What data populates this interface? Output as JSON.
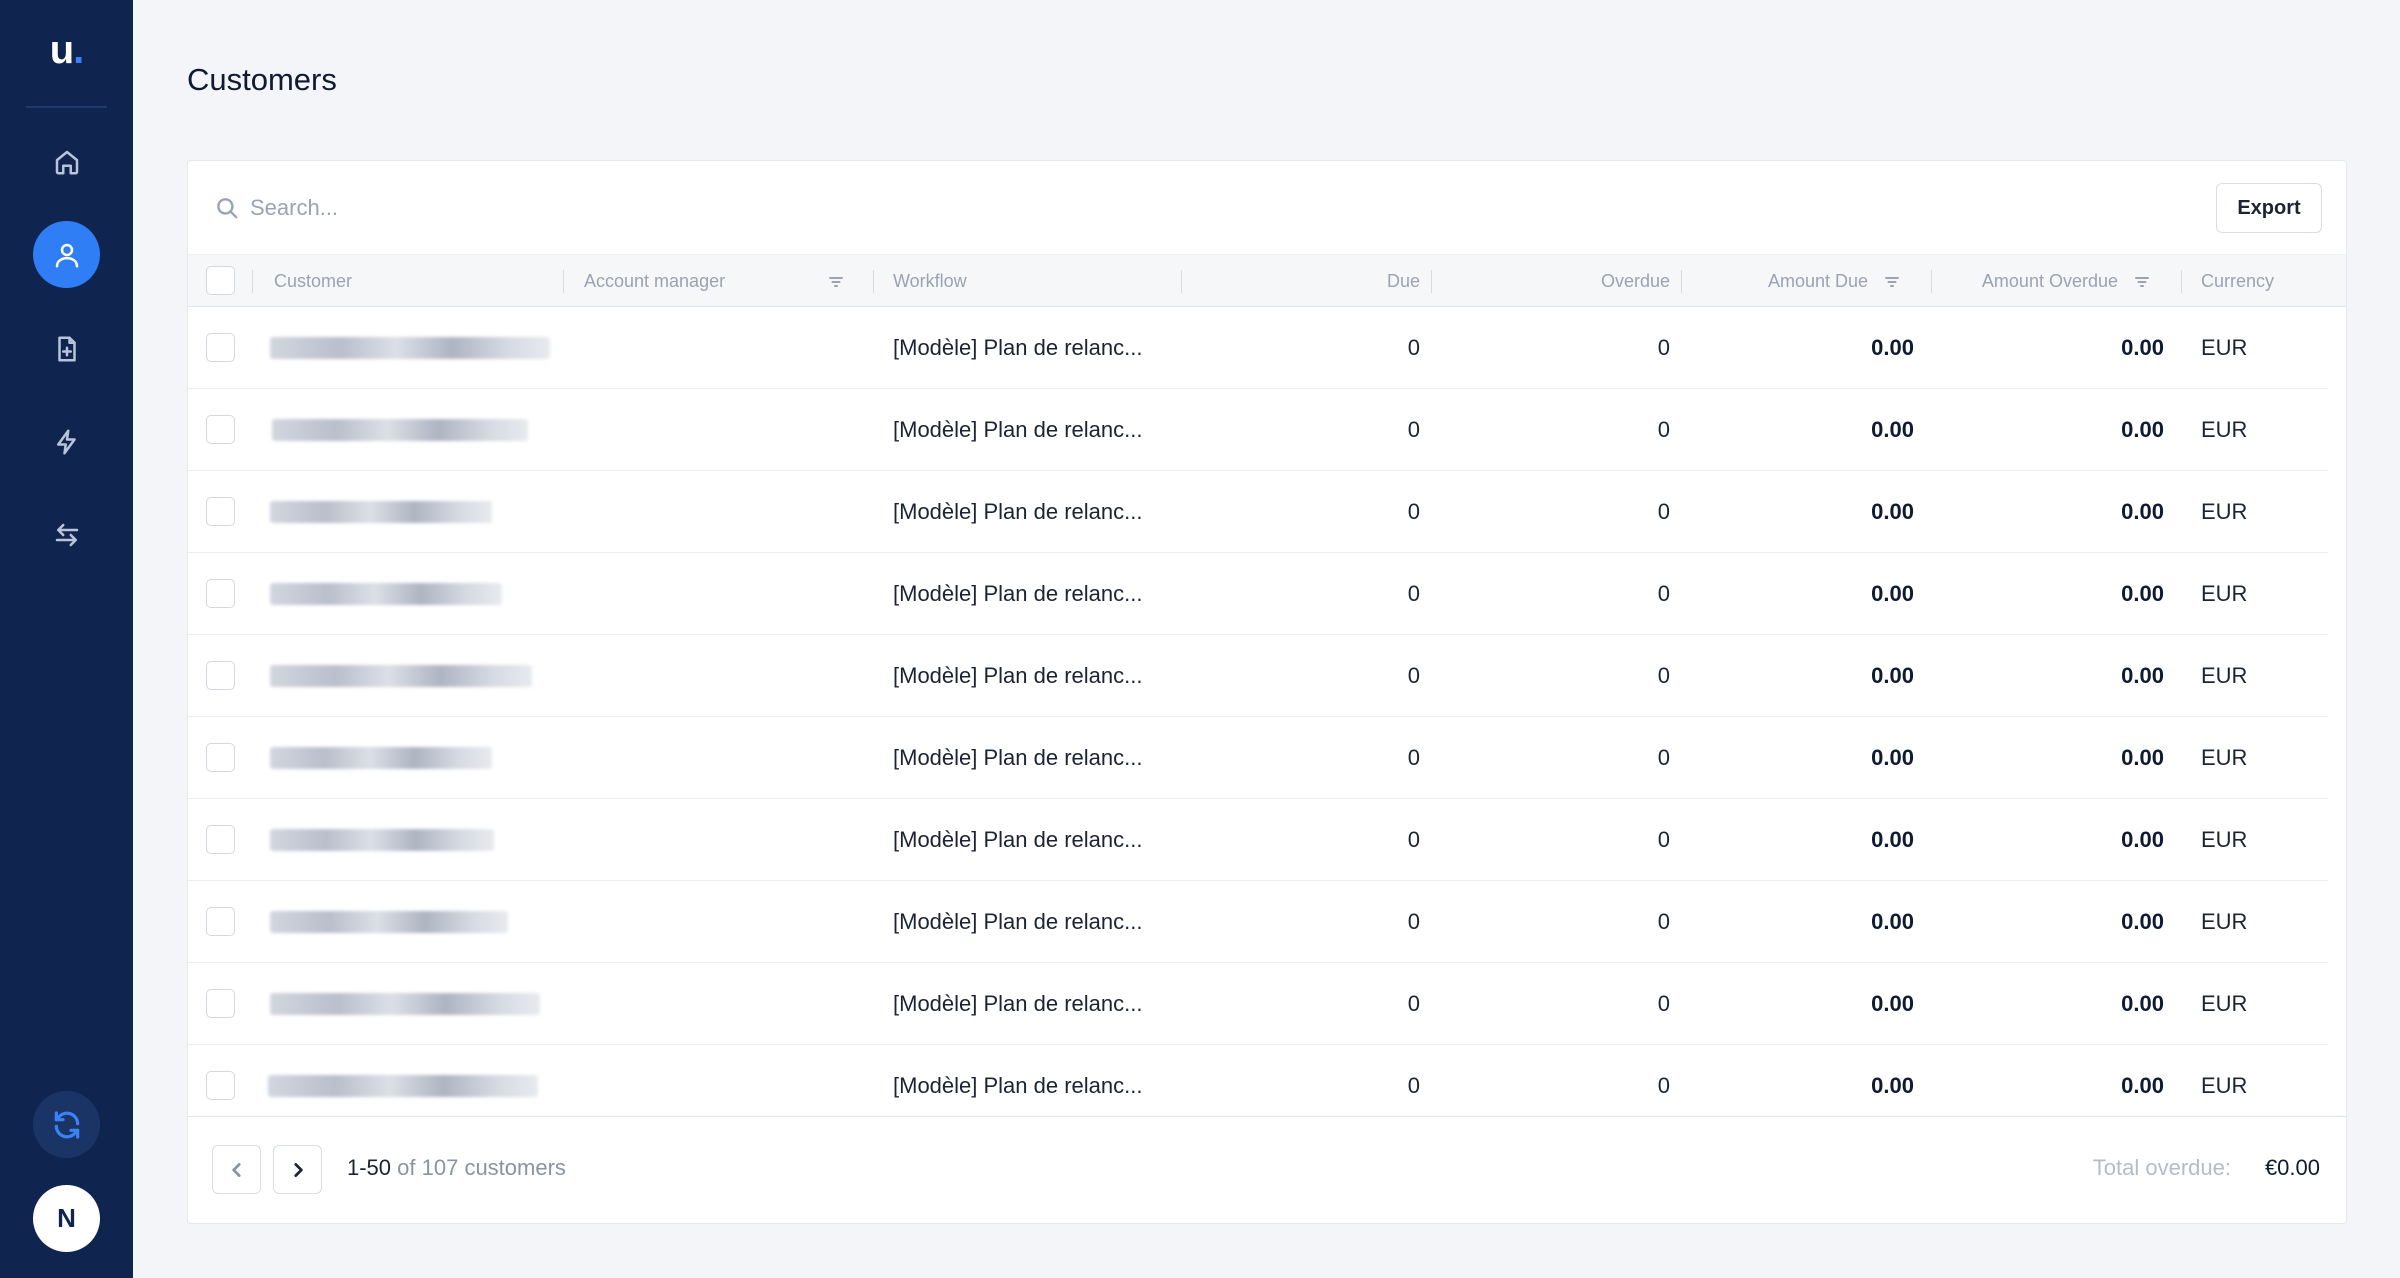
{
  "app": {
    "logo_text": "u",
    "logo_dot": "."
  },
  "sidebar": {
    "items": [
      {
        "name": "home-icon",
        "active": false
      },
      {
        "name": "user-icon",
        "active": true
      },
      {
        "name": "document-icon",
        "active": false
      },
      {
        "name": "lightning-icon",
        "active": false
      },
      {
        "name": "transfer-icon",
        "active": false
      }
    ],
    "sync_icon": "sync-icon",
    "avatar_initial": "N"
  },
  "page": {
    "title": "Customers"
  },
  "toolbar": {
    "search_placeholder": "Search...",
    "search_value": "",
    "export_label": "Export"
  },
  "table": {
    "columns": {
      "customer": "Customer",
      "account_manager": "Account manager",
      "workflow": "Workflow",
      "due": "Due",
      "overdue": "Overdue",
      "amount_due": "Amount Due",
      "amount_overdue": "Amount Overdue",
      "currency": "Currency"
    },
    "rows": [
      {
        "account_manager": "",
        "workflow": "[Modèle] Plan de relanc...",
        "due": "0",
        "overdue": "0",
        "amount_due": "0.00",
        "amount_overdue": "0.00",
        "currency": "EUR"
      },
      {
        "account_manager": "",
        "workflow": "[Modèle] Plan de relanc...",
        "due": "0",
        "overdue": "0",
        "amount_due": "0.00",
        "amount_overdue": "0.00",
        "currency": "EUR"
      },
      {
        "account_manager": "",
        "workflow": "[Modèle] Plan de relanc...",
        "due": "0",
        "overdue": "0",
        "amount_due": "0.00",
        "amount_overdue": "0.00",
        "currency": "EUR"
      },
      {
        "account_manager": "",
        "workflow": "[Modèle] Plan de relanc...",
        "due": "0",
        "overdue": "0",
        "amount_due": "0.00",
        "amount_overdue": "0.00",
        "currency": "EUR"
      },
      {
        "account_manager": "",
        "workflow": "[Modèle] Plan de relanc...",
        "due": "0",
        "overdue": "0",
        "amount_due": "0.00",
        "amount_overdue": "0.00",
        "currency": "EUR"
      },
      {
        "account_manager": "",
        "workflow": "[Modèle] Plan de relanc...",
        "due": "0",
        "overdue": "0",
        "amount_due": "0.00",
        "amount_overdue": "0.00",
        "currency": "EUR"
      },
      {
        "account_manager": "",
        "workflow": "[Modèle] Plan de relanc...",
        "due": "0",
        "overdue": "0",
        "amount_due": "0.00",
        "amount_overdue": "0.00",
        "currency": "EUR"
      },
      {
        "account_manager": "",
        "workflow": "[Modèle] Plan de relanc...",
        "due": "0",
        "overdue": "0",
        "amount_due": "0.00",
        "amount_overdue": "0.00",
        "currency": "EUR"
      },
      {
        "account_manager": "",
        "workflow": "[Modèle] Plan de relanc...",
        "due": "0",
        "overdue": "0",
        "amount_due": "0.00",
        "amount_overdue": "0.00",
        "currency": "EUR"
      },
      {
        "account_manager": "",
        "workflow": "[Modèle] Plan de relanc...",
        "due": "0",
        "overdue": "0",
        "amount_due": "0.00",
        "amount_overdue": "0.00",
        "currency": "EUR"
      }
    ]
  },
  "pagination": {
    "range": "1-50",
    "rest": "of 107 customers"
  },
  "summary": {
    "total_overdue_label": "Total overdue:",
    "total_overdue_value": "€0.00"
  }
}
